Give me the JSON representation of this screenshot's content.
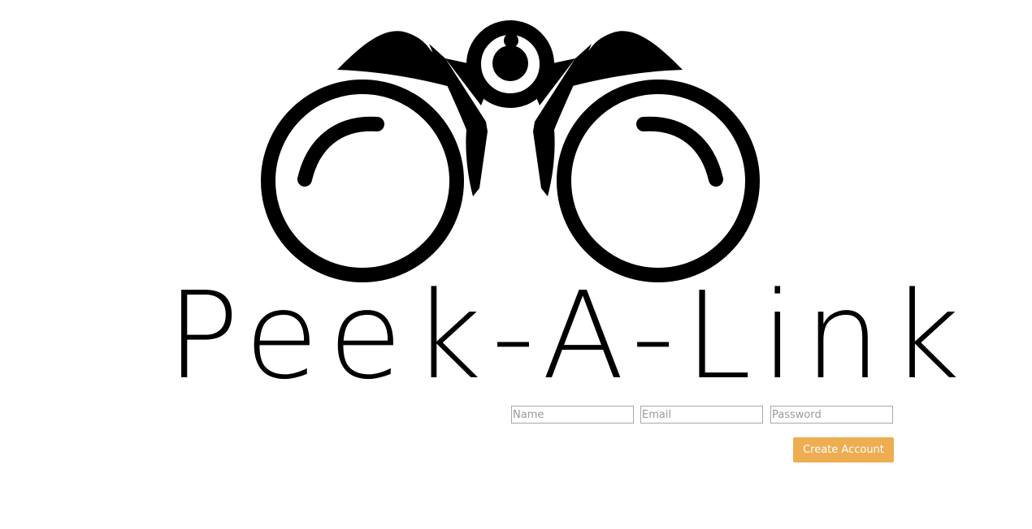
{
  "brand": {
    "title": "Peek-A-Link",
    "logo_icon": "binoculars-icon"
  },
  "signup": {
    "name_placeholder": "Name",
    "email_placeholder": "Email",
    "password_placeholder": "Password",
    "submit_label": "Create Account"
  },
  "colors": {
    "accent": "#efad52",
    "text": "#000000",
    "field_border": "#a8a8a8",
    "placeholder": "#9a9a9a",
    "background": "#ffffff"
  }
}
